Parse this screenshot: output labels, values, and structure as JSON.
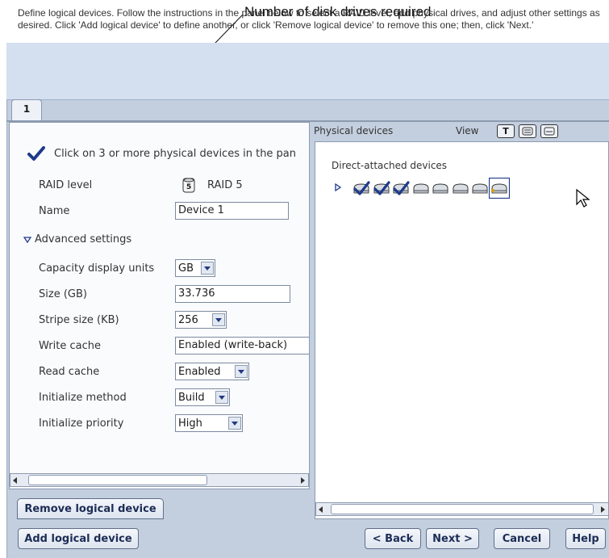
{
  "callout": {
    "text": "Number of disk drives required"
  },
  "instructions": {
    "text": "Define logical devices.  Follow the instructions in the panel below to select a RAID level, add physical drives, and adjust other settings as desired.  Click 'Add logical device' to define another, or click 'Remove logical device' to remove this one; then, click 'Next.'"
  },
  "tabs": [
    {
      "label": "1"
    }
  ],
  "left": {
    "hint": "Click on 3 or more physical devices in the pan",
    "raid_label": "RAID level",
    "raid_value": "RAID 5",
    "raid_icon_digit": "5",
    "name_label": "Name",
    "name_value": "Device 1",
    "advanced_label": "Advanced settings",
    "settings": {
      "capacity_units": {
        "label": "Capacity display units",
        "value": "GB"
      },
      "size": {
        "label": "Size (GB)",
        "value": "33.736"
      },
      "stripe": {
        "label": "Stripe size (KB)",
        "value": "256"
      },
      "write_cache": {
        "label": "Write cache",
        "value": "Enabled (write-back)"
      },
      "read_cache": {
        "label": "Read cache",
        "value": "Enabled"
      },
      "init_method": {
        "label": "Initialize method",
        "value": "Build"
      },
      "init_priority": {
        "label": "Initialize priority",
        "value": "High"
      }
    }
  },
  "right": {
    "header": "Physical devices",
    "view_label": "View",
    "view_icons": [
      "T",
      "list-icon",
      "details-icon"
    ],
    "group_label": "Direct-attached devices",
    "devices": [
      {
        "state": "selected"
      },
      {
        "state": "selected"
      },
      {
        "state": "selected"
      },
      {
        "state": "available"
      },
      {
        "state": "available"
      },
      {
        "state": "available"
      },
      {
        "state": "available"
      },
      {
        "state": "hover"
      }
    ]
  },
  "buttons": {
    "remove": "Remove logical device",
    "add": "Add logical device",
    "back": "< Back",
    "next": "Next >",
    "cancel": "Cancel",
    "help": "Help"
  },
  "colors": {
    "accent": "#1e3a8a",
    "frame": "#c3cfdf",
    "instruction_bg": "#d4dff0"
  }
}
